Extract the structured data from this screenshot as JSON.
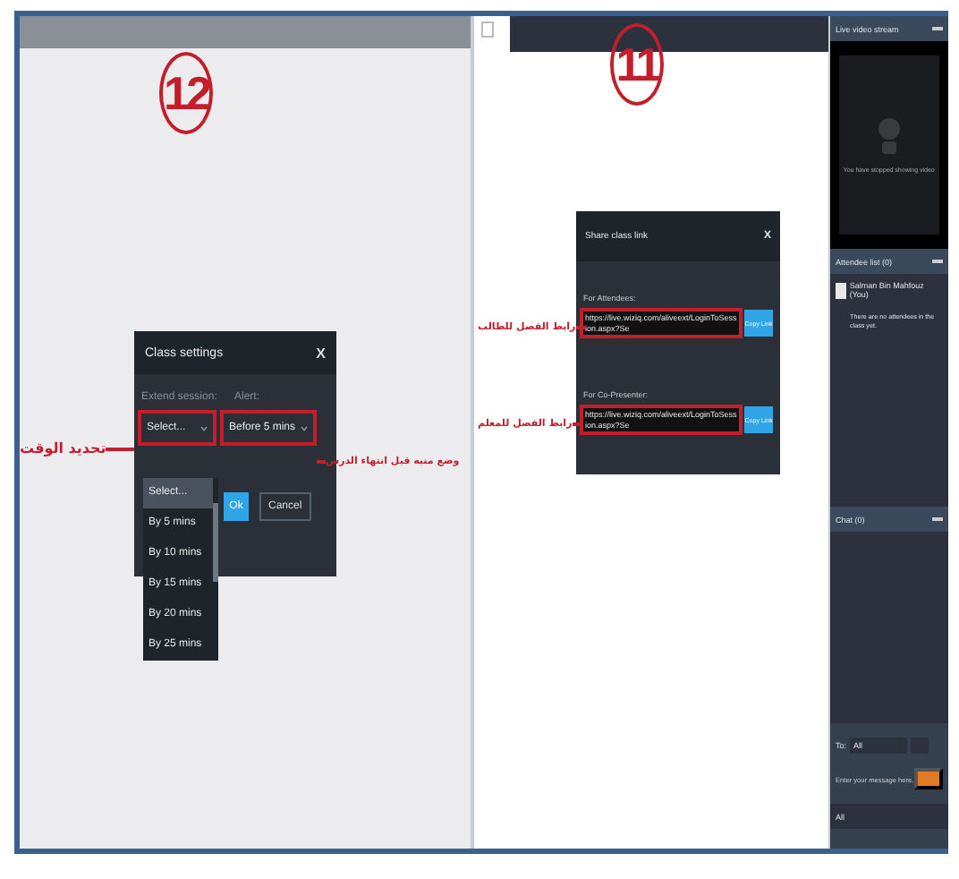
{
  "left_panel": {
    "step_number": "12",
    "dialog": {
      "title": "Class settings",
      "close": "X",
      "extend_label": "Extend session:",
      "alert_label": "Alert:",
      "extend_select": {
        "value": "Select...",
        "highlighted": true
      },
      "alert_select": {
        "value": "Before 5 mins",
        "highlighted": true
      },
      "extend_options": [
        {
          "label": "Select...",
          "selected": true
        },
        {
          "label": "By 5 mins",
          "selected": false
        },
        {
          "label": "By 10 mins",
          "selected": false
        },
        {
          "label": "By 15 mins",
          "selected": false
        },
        {
          "label": "By 20 mins",
          "selected": false
        },
        {
          "label": "By 25 mins",
          "selected": false
        }
      ],
      "buttons": [
        {
          "label": "Ok",
          "kind": "primary"
        },
        {
          "label": "Cancel",
          "kind": "secondary"
        }
      ]
    },
    "annotations": [
      {
        "text": "تحديد الوقت"
      },
      {
        "text": "وضع منبه قبل انتهاء الدرس"
      }
    ]
  },
  "right_panel": {
    "step_number": "11",
    "dialog": {
      "title": "Share class link",
      "close": "X",
      "links": [
        {
          "label": "For Attendees:",
          "url": "https://live.wiziq.com/aliveext/LoginToSession.aspx?Se",
          "button": "Copy Link",
          "highlighted": true,
          "annotation": "رابط الفصل للطالب"
        },
        {
          "label": "For Co-Presenter:",
          "url": "https://live.wiziq.com/aliveext/LoginToSession.aspx?Se",
          "button": "Copy Link",
          "highlighted": true,
          "annotation": "رابط الفصل للمعلم"
        }
      ]
    }
  },
  "sidebar": {
    "video": {
      "title": "Live video stream",
      "message": "You have stopped showing video"
    },
    "attendees": {
      "title": "Attendee list (0)",
      "user": "Salman Bin Mahfouz (You)",
      "empty": "There are no attendees in the class yet."
    },
    "chat": {
      "title": "Chat (0)",
      "to_label": "To:",
      "to_value": "All",
      "placeholder": "Enter your message here.",
      "footer": "All"
    }
  }
}
